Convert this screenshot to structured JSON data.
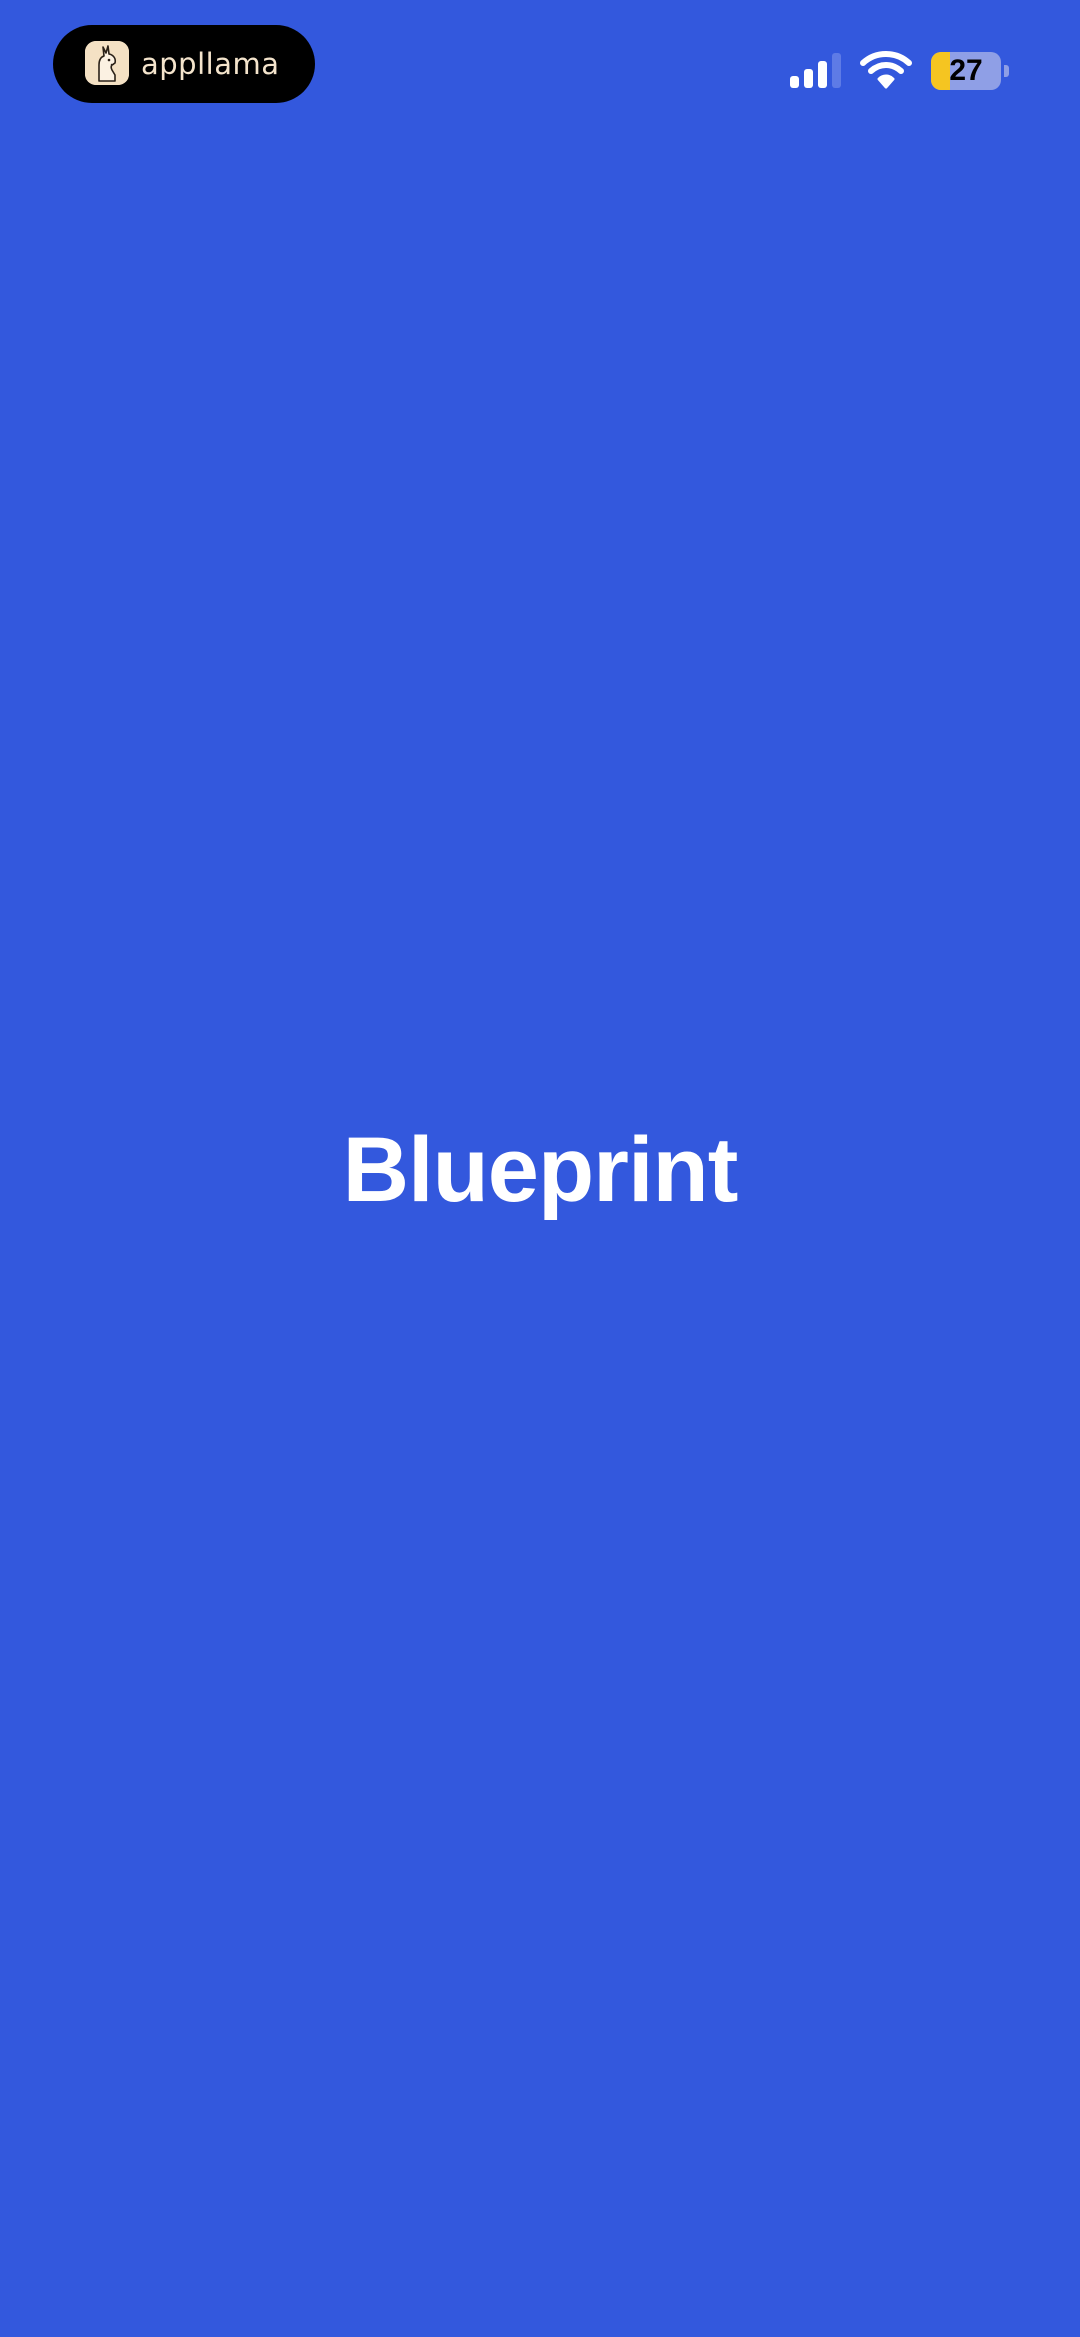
{
  "status_bar": {
    "island": {
      "app_icon": "llama-icon",
      "label": "appllama"
    },
    "signal": {
      "icon": "cellular-signal-icon",
      "bars_active": 3,
      "bars_total": 4
    },
    "wifi": {
      "icon": "wifi-icon"
    },
    "battery": {
      "icon": "battery-icon",
      "level": "27",
      "fill_fraction": 0.27,
      "color": "#F5C521"
    }
  },
  "splash": {
    "title": "Blueprint",
    "background_color": "#3358DD"
  }
}
